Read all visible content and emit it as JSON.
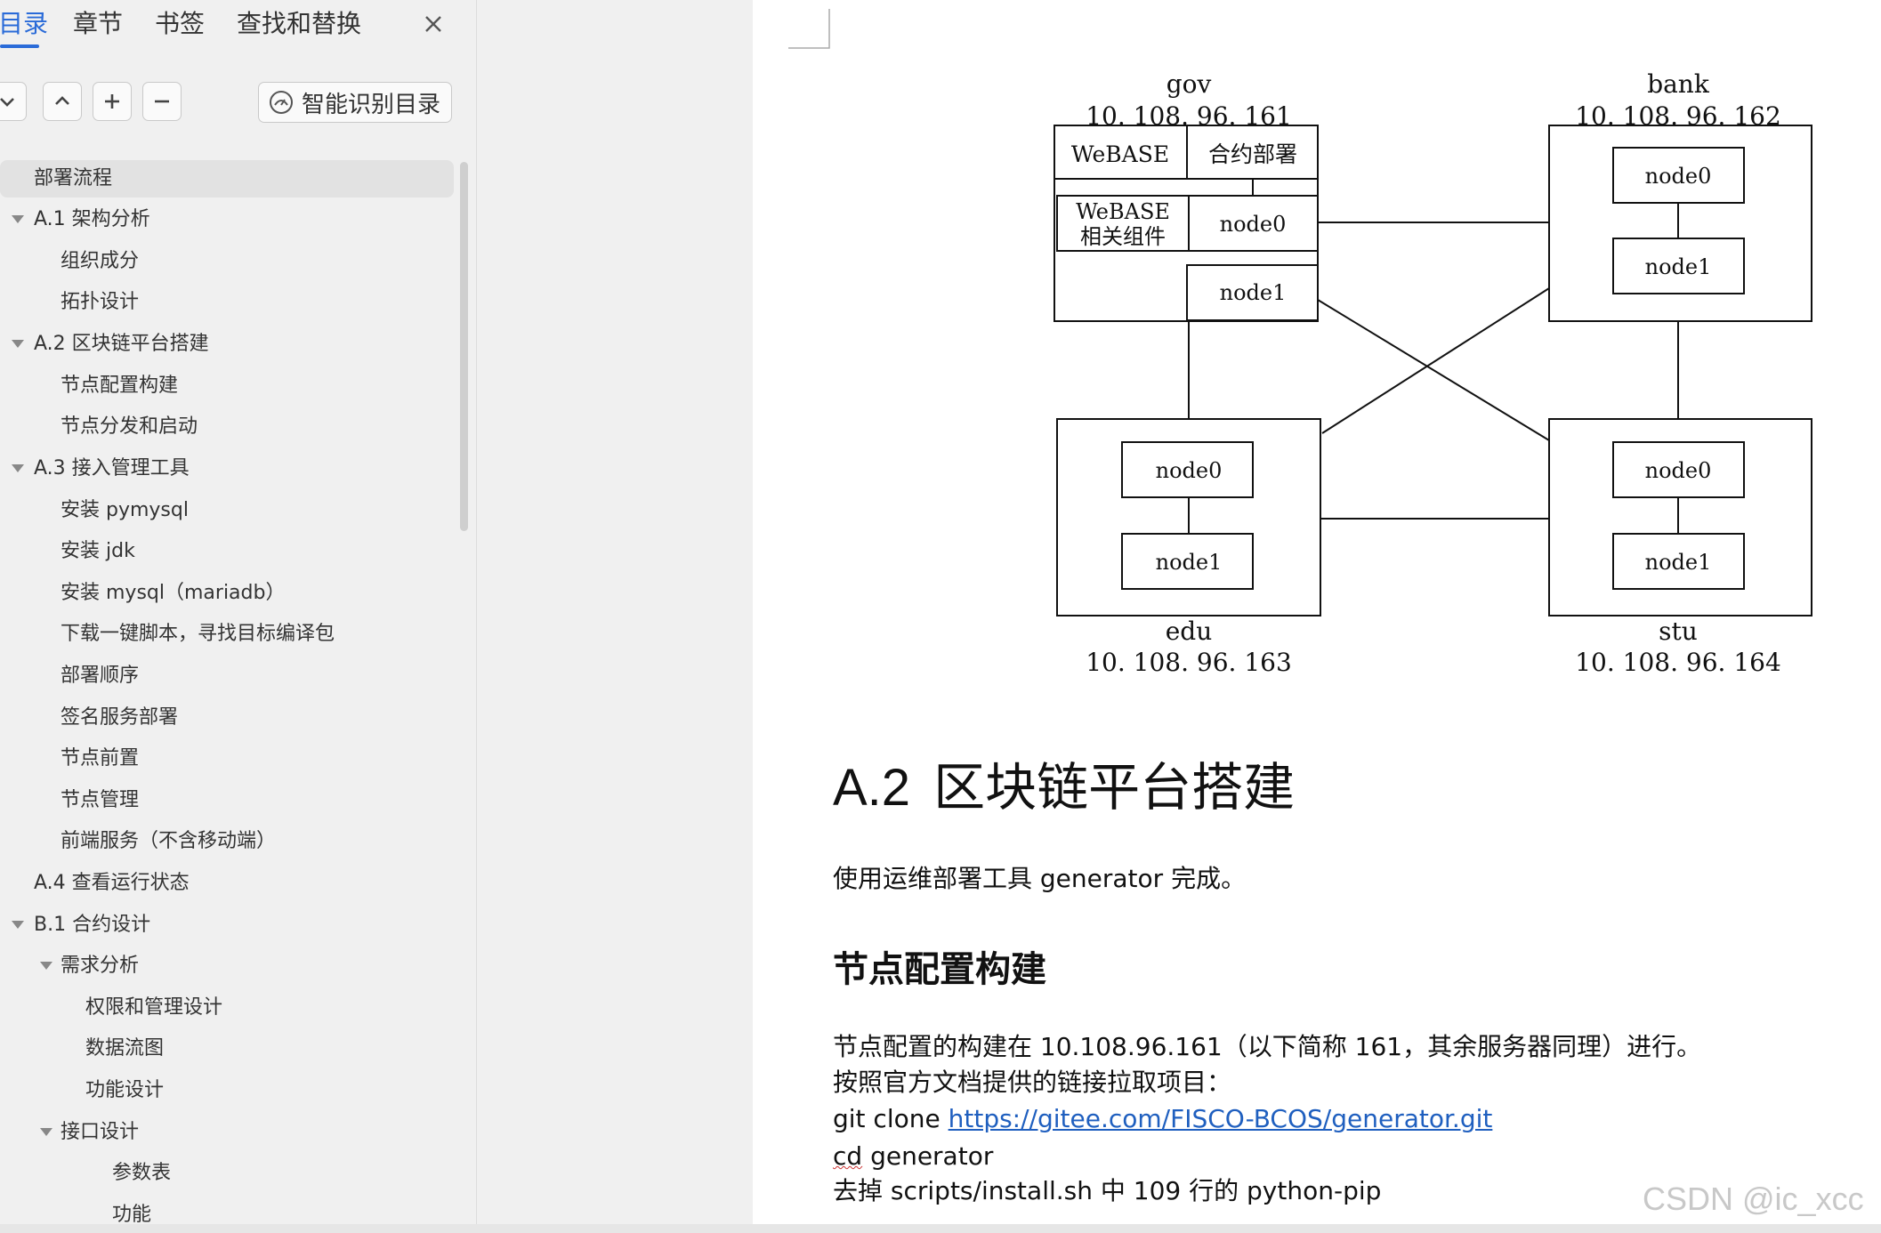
{
  "sidebar": {
    "tabs": [
      {
        "label": "目录",
        "active": true
      },
      {
        "label": "章节",
        "active": false
      },
      {
        "label": "书签",
        "active": false
      },
      {
        "label": "查找和替换",
        "active": false
      }
    ],
    "toolbar": {
      "collapse_icon": "chevron-down-icon",
      "expand_icon": "chevron-up-icon",
      "add_icon": "plus-icon",
      "remove_icon": "minus-icon",
      "ai_toc_label": "智能识别目录"
    },
    "toc": [
      {
        "label": "部署流程",
        "level": 0,
        "caret": false,
        "selected": true
      },
      {
        "label": "A.1 架构分析",
        "level": 0,
        "caret": true
      },
      {
        "label": "组织成分",
        "level": 1,
        "caret": false
      },
      {
        "label": "拓扑设计",
        "level": 1,
        "caret": false
      },
      {
        "label": "A.2  区块链平台搭建",
        "level": 0,
        "caret": true
      },
      {
        "label": "节点配置构建",
        "level": 1,
        "caret": false
      },
      {
        "label": "节点分发和启动",
        "level": 1,
        "caret": false
      },
      {
        "label": "A.3 接入管理工具",
        "level": 0,
        "caret": true
      },
      {
        "label": "安装 pymysql",
        "level": 1,
        "caret": false
      },
      {
        "label": "安装 jdk",
        "level": 1,
        "caret": false
      },
      {
        "label": "安装 mysql（mariadb）",
        "level": 1,
        "caret": false
      },
      {
        "label": "下载一键脚本，寻找目标编译包",
        "level": 1,
        "caret": false
      },
      {
        "label": "部署顺序",
        "level": 1,
        "caret": false
      },
      {
        "label": "签名服务部署",
        "level": 1,
        "caret": false
      },
      {
        "label": "节点前置",
        "level": 1,
        "caret": false
      },
      {
        "label": "节点管理",
        "level": 1,
        "caret": false
      },
      {
        "label": "前端服务（不含移动端）",
        "level": 1,
        "caret": false
      },
      {
        "label": "A.4  查看运行状态",
        "level": 0,
        "caret": false
      },
      {
        "label": "B.1 合约设计",
        "level": 0,
        "caret": true
      },
      {
        "label": "需求分析",
        "level": 1,
        "caret": true
      },
      {
        "label": "权限和管理设计",
        "level": 2,
        "caret": false
      },
      {
        "label": "数据流图",
        "level": 2,
        "caret": false
      },
      {
        "label": "功能设计",
        "level": 2,
        "caret": false
      },
      {
        "label": "接口设计",
        "level": 1,
        "caret": true
      },
      {
        "label": "参数表",
        "level": 3,
        "caret": false
      },
      {
        "label": "功能",
        "level": 3,
        "caret": false
      }
    ]
  },
  "diagram": {
    "gov": {
      "name": "gov",
      "ip": "10. 108. 96. 161",
      "webase": "WeBASE",
      "contract": "合约部署",
      "webase_components_1": "WeBASE",
      "webase_components_2": "相关组件",
      "node0": "node0",
      "node1": "node1"
    },
    "bank": {
      "name": "bank",
      "ip": "10. 108. 96. 162",
      "node0": "node0",
      "node1": "node1"
    },
    "edu": {
      "name": "edu",
      "ip": "10. 108. 96. 163",
      "node0": "node0",
      "node1": "node1"
    },
    "stu": {
      "name": "stu",
      "ip": "10. 108. 96. 164",
      "node0": "node0",
      "node1": "node1"
    }
  },
  "document": {
    "heading_num": "A.2",
    "heading_text": "区块链平台搭建",
    "intro": "使用运维部署工具 generator 完成。",
    "subheading": "节点配置构建",
    "line1": "节点配置的构建在 10.108.96.161（以下简称 161，其余服务器同理）进行。",
    "line2": "按照官方文档提供的链接拉取项目：",
    "line3_prefix": "git clone ",
    "line3_link": "https://gitee.com/FISCO-BCOS/generator.git",
    "line4_cmd": "cd",
    "line4_rest": " generator",
    "line5": "去掉 scripts/install.sh 中 109 行的 python-pip"
  },
  "watermark": "CSDN @ic_xcc",
  "colors": {
    "accent": "#2a6bd8",
    "link": "#1f5fbf"
  }
}
